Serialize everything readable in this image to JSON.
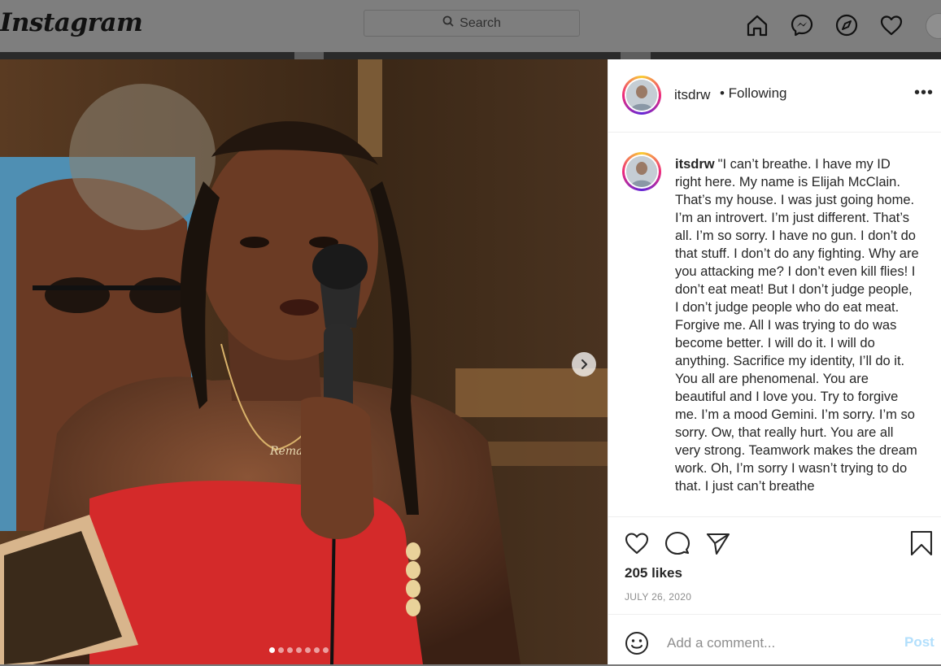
{
  "topbar": {
    "logo": "Instagram",
    "search_placeholder": "Search",
    "icons": [
      "home-icon",
      "messenger-icon",
      "explore-icon",
      "heart-icon"
    ]
  },
  "post": {
    "username": "itsdrw",
    "following_label": "• Following",
    "more_label": "•••",
    "caption": "\"I can’t breathe. I have my ID right here. My name is Elijah McClain. That’s my house. I was just going home. I’m an introvert. I’m just different. That’s all. I’m so sorry. I have no gun. I don’t do that stuff. I don’t do any fighting. Why are you attacking me? I don’t even kill flies! I don’t eat meat! But I don’t judge people, I don’t judge people who do eat meat. Forgive me. All I was trying to do was become better. I will do it. I will do anything. Sacrifice my identity, I’ll do it. You all are phenomenal. You are beautiful and I love you. Try to forgive me. I’m a mood Gemini. I’m sorry. I’m so sorry. Ow, that really hurt. You are all very strong. Teamwork makes the dream work. Oh, I’m sorry I wasn’t trying to do that. I just can’t breathe",
    "likes": "205 likes",
    "date": "JULY 26, 2020",
    "comment_placeholder": "Add a comment...",
    "post_button": "Post",
    "carousel": {
      "slide_count": 7,
      "active_index": 0
    },
    "image_text": "Remae"
  },
  "colors": {
    "post_button_disabled": "#b2dffc",
    "text": "#262626",
    "muted": "#8e8e8e"
  }
}
